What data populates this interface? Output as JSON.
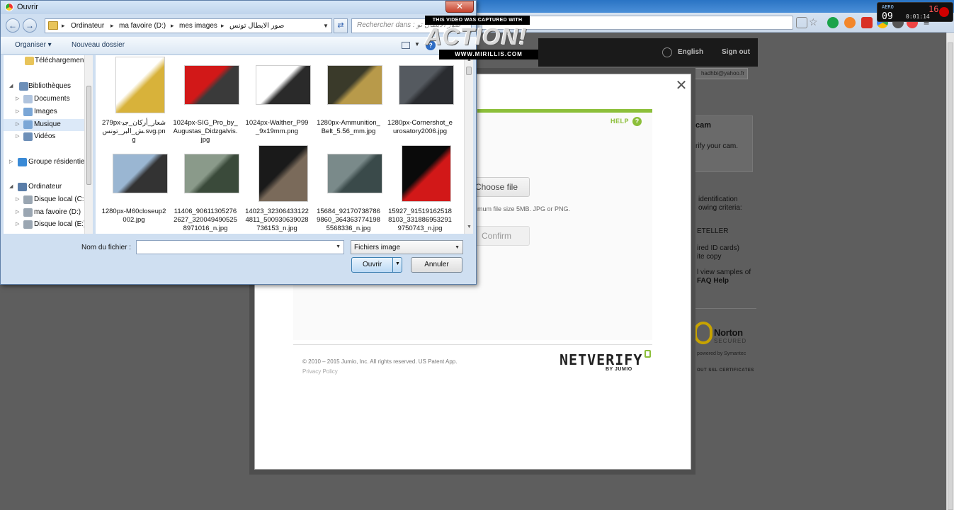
{
  "dialog": {
    "title": "Ouvrir",
    "close_glyph": "✕",
    "breadcrumb": [
      "Ordinateur",
      "ma favoire (D:)",
      "mes images",
      "صور الابطال تونس"
    ],
    "search_placeholder": "Rechercher dans : صور الأبطال تو",
    "toolbar": {
      "organize": "Organiser ▾",
      "new_folder": "Nouveau dossier"
    },
    "nav": [
      {
        "label": "Téléchargement",
        "icon": "folder-icon",
        "color": "#e8c45a"
      },
      {
        "label": "Bibliothèques",
        "icon": "library-icon",
        "color": "#6d8fb8"
      },
      {
        "label": "Documents",
        "icon": "documents-icon",
        "color": "#b0c4de"
      },
      {
        "label": "Images",
        "icon": "images-icon",
        "color": "#7aa6d6"
      },
      {
        "label": "Musique",
        "icon": "music-icon",
        "color": "#7aa6d6"
      },
      {
        "label": "Vidéos",
        "icon": "videos-icon",
        "color": "#6d8fb8"
      },
      {
        "label": "Groupe résidentie",
        "icon": "homegroup-icon",
        "color": "#3a8ad6"
      },
      {
        "label": "Ordinateur",
        "icon": "computer-icon",
        "color": "#5a7da8"
      },
      {
        "label": "Disque local (C:)",
        "icon": "drive-icon",
        "color": "#9aa6b2"
      },
      {
        "label": "ma favoire (D:)",
        "icon": "drive-icon",
        "color": "#9aa6b2"
      },
      {
        "label": "Disque local (E:)",
        "icon": "drive-icon",
        "color": "#9aa6b2"
      }
    ],
    "files": [
      {
        "name": "279px-شعار_أركان_جيش_البر_تونس.svg.png",
        "colors": [
          "#ffffff",
          "#d8b23a"
        ]
      },
      {
        "name": "1024px-SIG_Pro_by_Augustas_Didzgalvis.jpg",
        "colors": [
          "#d21818",
          "#3a3a3a"
        ]
      },
      {
        "name": "1024px-Walther_P99_9x19mm.png",
        "colors": [
          "#ffffff",
          "#2a2a2a"
        ]
      },
      {
        "name": "1280px-Ammunition_Belt_5.56_mm.jpg",
        "colors": [
          "#3a3a2a",
          "#b89a4a"
        ]
      },
      {
        "name": "1280px-Cornershot_eurosatory2006.jpg",
        "colors": [
          "#555a60",
          "#2a2c30"
        ]
      },
      {
        "name": "1280px-M60closeup2002.jpg",
        "colors": [
          "#9ab6d2",
          "#333333"
        ]
      },
      {
        "name": "11406_906113052762627_3200494905258971016_n.jpg",
        "colors": [
          "#8a9a8a",
          "#3a4a3a"
        ]
      },
      {
        "name": "14023_323064331224811_500930639028736153_n.jpg",
        "colors": [
          "#1a1a1a",
          "#7a6a5a"
        ]
      },
      {
        "name": "15684_921707387869860_3643637741985568336_n.jpg",
        "colors": [
          "#7a8a8a",
          "#3a4a4a"
        ]
      },
      {
        "name": "15927_915191625188103_3318869532919750743_n.jpg",
        "colors": [
          "#0a0a0a",
          "#d21818"
        ]
      }
    ],
    "filename_label": "Nom du fichier :",
    "filename_value": "",
    "filetype": "Fichiers image",
    "open_label": "Ouvrir",
    "cancel_label": "Annuler"
  },
  "watermark": {
    "line1": "THIS VIDEO WAS CAPTURED WITH",
    "brand": "ACTION!",
    "site": "WWW.MIRILLIS.COM"
  },
  "recorder": {
    "label": "AERO",
    "value": "09",
    "time": "0:01:14",
    "fps": "16"
  },
  "site": {
    "language": "English",
    "signout": "Sign out",
    "email": "hadhbi@yahoo.fr",
    "cam_title": "cam",
    "cam_text": "rify your cam.",
    "side_lines": [
      "identification",
      "owing criteria:",
      "ETELLER",
      "ired ID cards)",
      "ite copy",
      "l view samples of",
      "FAQ Help"
    ],
    "norton": {
      "name": "Norton",
      "secured": "SECURED",
      "by": "powered by Symantec",
      "ssl": "OUT SSL CERTIFICATES"
    }
  },
  "modal": {
    "close_glyph": "✕",
    "help": "HELP",
    "help_glyph": "?",
    "choose_file": "Choose file",
    "size_hint": "mum file size 5MB. JPG or PNG.",
    "confirm": "Confirm",
    "copyright": "© 2010 – 2015 Jumio, Inc. All rights reserved. US Patent App.",
    "privacy": "Privacy Policy",
    "logo": "NETVERIFY",
    "logo_sub": "BY JUMIO",
    "progress": 1.0,
    "accent": "#8cbf3a"
  }
}
